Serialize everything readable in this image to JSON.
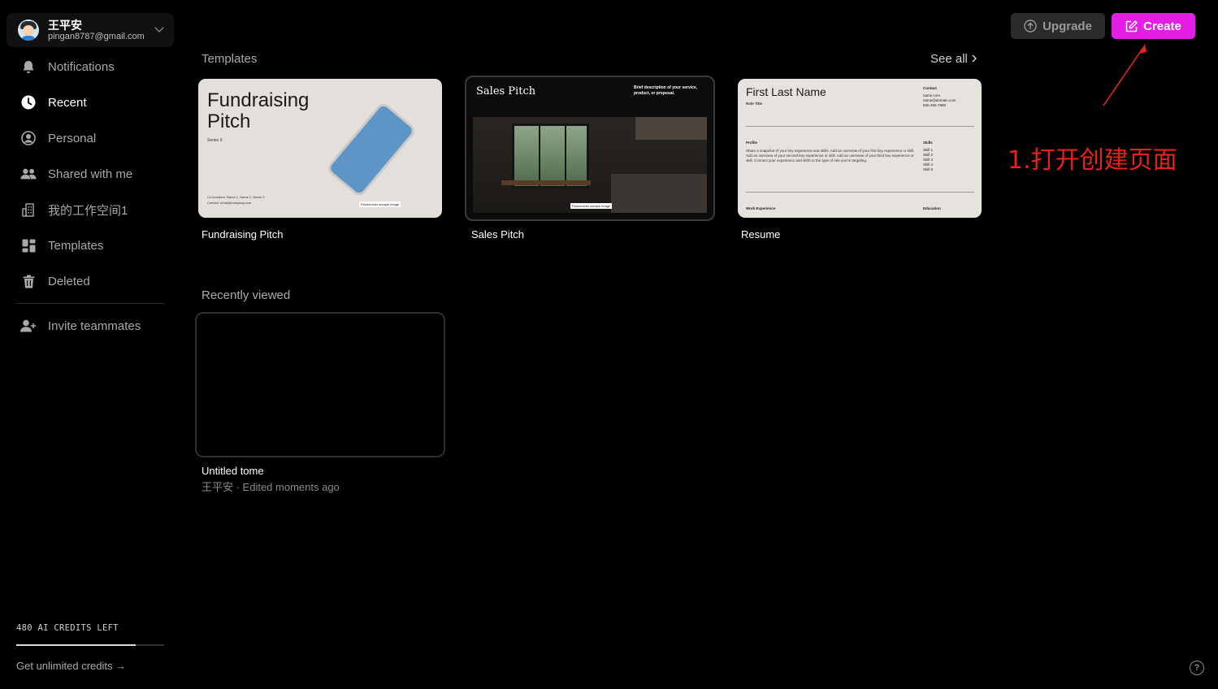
{
  "account": {
    "name": "王平安",
    "email": "pingan8787@gmail.com"
  },
  "nav": {
    "items": [
      {
        "label": "Notifications",
        "icon": "bell-icon"
      },
      {
        "label": "Recent",
        "icon": "clock-icon",
        "active": true
      },
      {
        "label": "Personal",
        "icon": "user-circle-icon"
      },
      {
        "label": "Shared with me",
        "icon": "users-icon"
      },
      {
        "label": "我的工作空间1",
        "icon": "building-icon"
      },
      {
        "label": "Templates",
        "icon": "grid-icon"
      },
      {
        "label": "Deleted",
        "icon": "trash-icon"
      }
    ],
    "invite": "Invite teammates"
  },
  "credits": {
    "text": "480 AI CREDITS LEFT",
    "fraction": 0.81,
    "cta": "Get unlimited credits"
  },
  "header": {
    "upgrade_label": "Upgrade",
    "create_label": "Create"
  },
  "templates": {
    "title": "Templates",
    "see_all": "See all",
    "cards": [
      {
        "label": "Fundraising Pitch",
        "heading": "Fundraising Pitch",
        "subtitle": "Series X",
        "footer1": "Co founders: Name 1, Name 2, Name 3",
        "footer2": "Contact: email@company.com",
        "caption": "Placeholder sample image"
      },
      {
        "label": "Sales Pitch",
        "heading": "Sales Pitch",
        "description": "Brief description of your service, product, or proposal.",
        "caption": "Placeholder sample image"
      },
      {
        "label": "Resume",
        "name": "First Last Name",
        "role": "Role Title",
        "contact_heading": "Contact",
        "contact_lines": [
          "name.com",
          "name@domain.com",
          "555-456-7890"
        ],
        "profile_heading": "Profile",
        "profile_body": "Share a snapshot of your key experience and skills. Add an overview of your first key experience or skill. Add an overview of your second key experience or skill. Add an overview of your third key experience or skill. Connect your experience and skills to the type of role you're targeting.",
        "skills_heading": "Skills",
        "skills": [
          "Skill 1",
          "Skill 2",
          "Skill 3",
          "Skill 4",
          "Skill 5"
        ],
        "work_heading": "Work Experience",
        "education_heading": "Education"
      }
    ]
  },
  "recent": {
    "title": "Recently viewed",
    "item": {
      "title": "Untitled tome",
      "meta": "王平安 · Edited moments ago"
    }
  },
  "annotation": "1.打开创建页面",
  "colors": {
    "create": "#e51ee5",
    "annotation": "#e8211c"
  }
}
